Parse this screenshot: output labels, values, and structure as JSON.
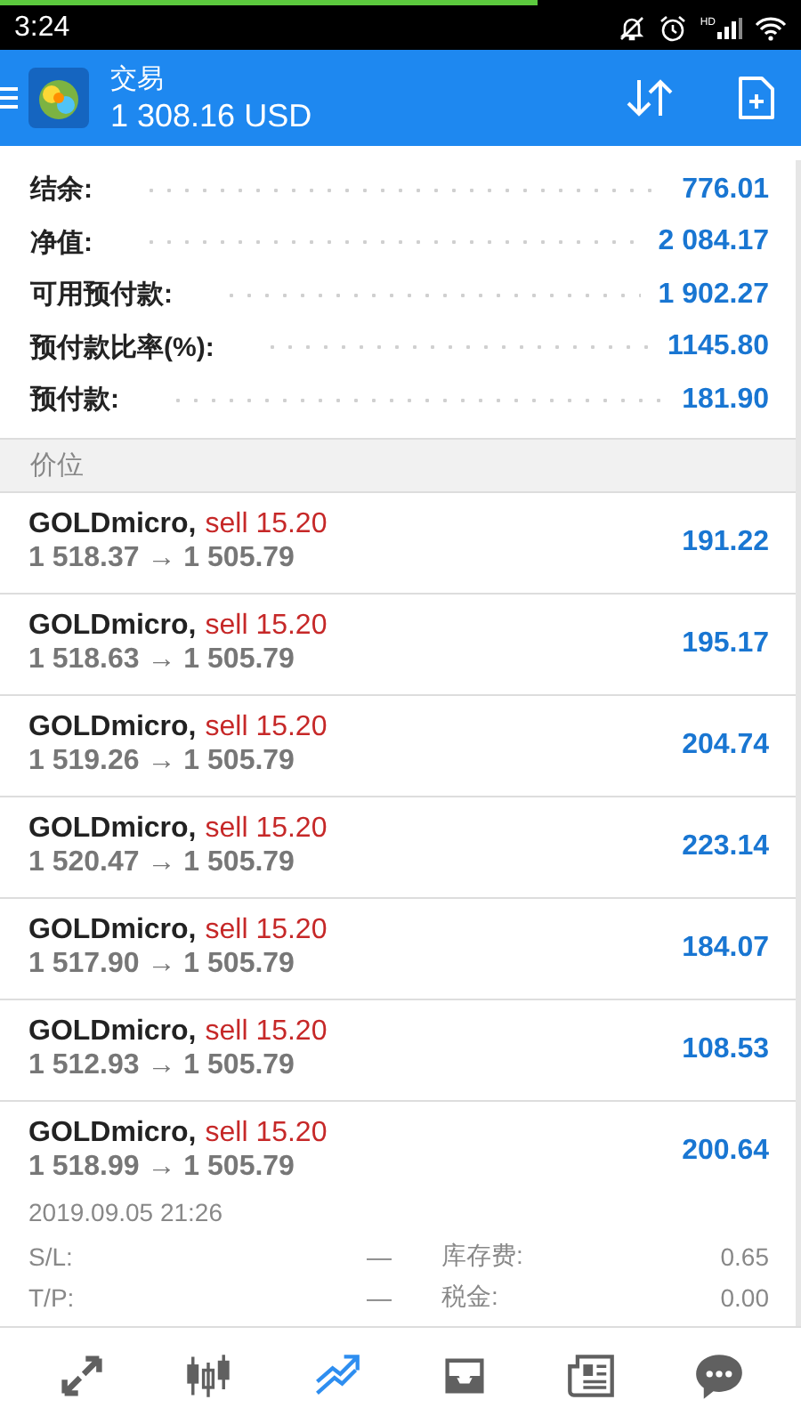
{
  "loading_bar": {
    "level": 0.67
  },
  "status_bar": {
    "time": "3:24",
    "signal_label": "HD"
  },
  "header": {
    "title": "交易",
    "balance": "1 308.16 USD"
  },
  "summary": [
    {
      "label": "结余:",
      "value": "776.01"
    },
    {
      "label": "净值:",
      "value": "2 084.17"
    },
    {
      "label": "可用预付款:",
      "value": "1 902.27"
    },
    {
      "label": "预付款比率(%):",
      "value": "1145.80"
    },
    {
      "label": "预付款:",
      "value": "181.90"
    }
  ],
  "section_title": "价位",
  "positions": [
    {
      "symbol": "GOLDmicro,",
      "side": "sell 15.20",
      "prices": "1 518.37 → 1 505.79",
      "profit": "191.22"
    },
    {
      "symbol": "GOLDmicro,",
      "side": "sell 15.20",
      "prices": "1 518.63 → 1 505.79",
      "profit": "195.17"
    },
    {
      "symbol": "GOLDmicro,",
      "side": "sell 15.20",
      "prices": "1 519.26 → 1 505.79",
      "profit": "204.74"
    },
    {
      "symbol": "GOLDmicro,",
      "side": "sell 15.20",
      "prices": "1 520.47 → 1 505.79",
      "profit": "223.14"
    },
    {
      "symbol": "GOLDmicro,",
      "side": "sell 15.20",
      "prices": "1 517.90 → 1 505.79",
      "profit": "184.07"
    },
    {
      "symbol": "GOLDmicro,",
      "side": "sell 15.20",
      "prices": "1 512.93 → 1 505.79",
      "profit": "108.53"
    },
    {
      "symbol": "GOLDmicro,",
      "side": "sell 15.20",
      "prices": "1 518.99 → 1 505.79",
      "profit": "200.64",
      "details": {
        "time": "2019.09.05 21:26",
        "fields": [
          {
            "label": "S/L:",
            "value": "—",
            "label2": "库存费:",
            "value2": "0.65"
          },
          {
            "label": "T/P:",
            "value": "—",
            "label2": "税金:",
            "value2": "0.00"
          }
        ]
      }
    }
  ],
  "nav": [
    {
      "kind": "trade",
      "selected": false
    },
    {
      "kind": "chart",
      "selected": false
    },
    {
      "kind": "trend",
      "selected": true
    },
    {
      "kind": "inbox",
      "selected": false
    },
    {
      "kind": "news",
      "selected": false
    },
    {
      "kind": "chat",
      "selected": false
    }
  ]
}
